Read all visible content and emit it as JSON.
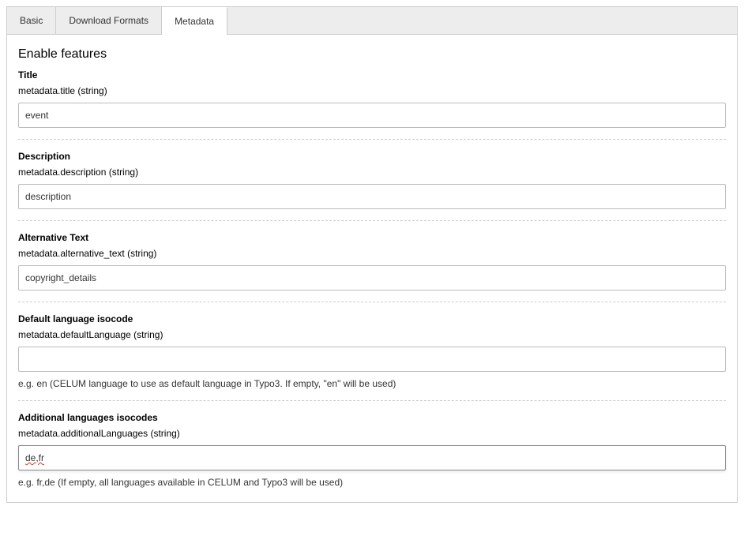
{
  "tabs": [
    {
      "label": "Basic",
      "active": false
    },
    {
      "label": "Download Formats",
      "active": false
    },
    {
      "label": "Metadata",
      "active": true
    }
  ],
  "panel": {
    "heading": "Enable features",
    "fields": [
      {
        "label": "Title",
        "key": "metadata.title (string)",
        "value": "event",
        "help": "",
        "focused": false
      },
      {
        "label": "Description",
        "key": "metadata.description (string)",
        "value": "description",
        "help": "",
        "focused": false
      },
      {
        "label": "Alternative Text",
        "key": "metadata.alternative_text (string)",
        "value": "copyright_details",
        "help": "",
        "focused": false
      },
      {
        "label": "Default language isocode",
        "key": "metadata.defaultLanguage (string)",
        "value": "",
        "help": "e.g. en (CELUM language to use as default language in Typo3. If empty, \"en\" will be used)",
        "focused": false
      },
      {
        "label": "Additional languages isocodes",
        "key": "metadata.additionalLanguages (string)",
        "value": "de,fr",
        "help": "e.g. fr,de (If empty, all languages available in CELUM and Typo3 will be used)",
        "focused": true
      }
    ]
  }
}
